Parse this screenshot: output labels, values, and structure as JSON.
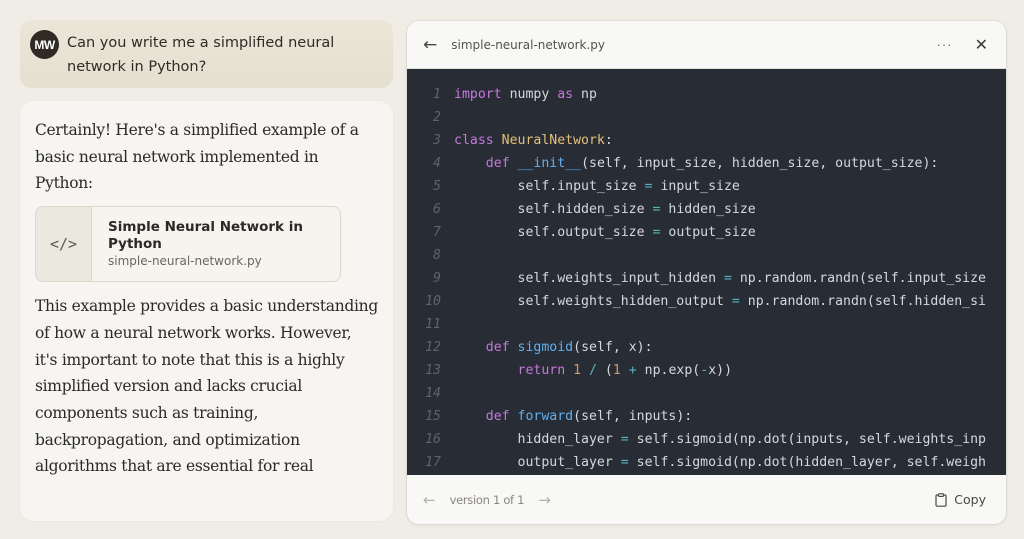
{
  "user_message": {
    "avatar_initials": "MW",
    "text": "Can you write me a simplified neural network in Python?"
  },
  "assistant_message": {
    "intro": "Certainly! Here's a simplified example of a basic neural network implemented in Python:",
    "artifact": {
      "icon": "code-icon",
      "icon_glyph": "</>",
      "title": "Simple Neural Network in Python",
      "filename": "simple-neural-network.py"
    },
    "outro": "This example provides a basic understanding of how a neural network works. However, it's important to note that this is a highly simplified version and lacks crucial components such as training, backpropagation, and optimization algorithms that are essential for real"
  },
  "code_panel": {
    "back_icon": "arrow-left-icon",
    "title": "simple-neural-network.py",
    "more_icon": "more-horizontal-icon",
    "more_glyph": "···",
    "close_icon": "close-icon",
    "close_glyph": "✕",
    "code_lines": [
      {
        "n": "1",
        "tokens": [
          [
            "kw",
            "import"
          ],
          [
            "src",
            " numpy "
          ],
          [
            "kw",
            "as"
          ],
          [
            "src",
            " np"
          ]
        ]
      },
      {
        "n": "2",
        "tokens": []
      },
      {
        "n": "3",
        "tokens": [
          [
            "kw",
            "class"
          ],
          [
            "src",
            " "
          ],
          [
            "cls",
            "NeuralNetwork"
          ],
          [
            "src",
            ":"
          ]
        ]
      },
      {
        "n": "4",
        "tokens": [
          [
            "src",
            "    "
          ],
          [
            "kw",
            "def"
          ],
          [
            "src",
            " "
          ],
          [
            "fn",
            "__init__"
          ],
          [
            "src",
            "(self, input_size, hidden_size, output_size):"
          ]
        ]
      },
      {
        "n": "5",
        "tokens": [
          [
            "src",
            "        self.input_size "
          ],
          [
            "op",
            "="
          ],
          [
            "src",
            " input_size"
          ]
        ]
      },
      {
        "n": "6",
        "tokens": [
          [
            "src",
            "        self.hidden_size "
          ],
          [
            "op",
            "="
          ],
          [
            "src",
            " hidden_size"
          ]
        ]
      },
      {
        "n": "7",
        "tokens": [
          [
            "src",
            "        self.output_size "
          ],
          [
            "op",
            "="
          ],
          [
            "src",
            " output_size"
          ]
        ]
      },
      {
        "n": "8",
        "tokens": []
      },
      {
        "n": "9",
        "tokens": [
          [
            "src",
            "        self.weights_input_hidden "
          ],
          [
            "op",
            "="
          ],
          [
            "src",
            " np.random.randn(self.input_size"
          ]
        ]
      },
      {
        "n": "10",
        "tokens": [
          [
            "src",
            "        self.weights_hidden_output "
          ],
          [
            "op",
            "="
          ],
          [
            "src",
            " np.random.randn(self.hidden_si"
          ]
        ]
      },
      {
        "n": "11",
        "tokens": []
      },
      {
        "n": "12",
        "tokens": [
          [
            "src",
            "    "
          ],
          [
            "kw",
            "def"
          ],
          [
            "src",
            " "
          ],
          [
            "fn",
            "sigmoid"
          ],
          [
            "src",
            "(self, x):"
          ]
        ]
      },
      {
        "n": "13",
        "tokens": [
          [
            "src",
            "        "
          ],
          [
            "kw",
            "return"
          ],
          [
            "src",
            " "
          ],
          [
            "num",
            "1"
          ],
          [
            "src",
            " "
          ],
          [
            "op",
            "/"
          ],
          [
            "src",
            " ("
          ],
          [
            "num",
            "1"
          ],
          [
            "src",
            " "
          ],
          [
            "op",
            "+"
          ],
          [
            "src",
            " np.exp("
          ],
          [
            "op",
            "-"
          ],
          [
            "src",
            "x))"
          ]
        ]
      },
      {
        "n": "14",
        "tokens": []
      },
      {
        "n": "15",
        "tokens": [
          [
            "src",
            "    "
          ],
          [
            "kw",
            "def"
          ],
          [
            "src",
            " "
          ],
          [
            "fn",
            "forward"
          ],
          [
            "src",
            "(self, inputs):"
          ]
        ]
      },
      {
        "n": "16",
        "tokens": [
          [
            "src",
            "        hidden_layer "
          ],
          [
            "op",
            "="
          ],
          [
            "src",
            " self.sigmoid(np.dot(inputs, self.weights_inp"
          ]
        ]
      },
      {
        "n": "17",
        "tokens": [
          [
            "src",
            "        output_layer "
          ],
          [
            "op",
            "="
          ],
          [
            "src",
            " self.sigmoid(np.dot(hidden_layer, self.weigh"
          ]
        ]
      }
    ],
    "footer": {
      "prev_icon": "arrow-left-icon",
      "version_text": "version 1 of 1",
      "next_icon": "arrow-right-icon",
      "copy_icon": "clipboard-icon",
      "copy_label": "Copy"
    }
  },
  "colors": {
    "page_bg": "#efede6",
    "user_bubble": "#e8e3d4",
    "code_bg": "#282c34",
    "keyword": "#c678dd",
    "class_name": "#e5c07b",
    "function": "#61afef",
    "operator": "#56b6c2",
    "number": "#d19a66"
  }
}
